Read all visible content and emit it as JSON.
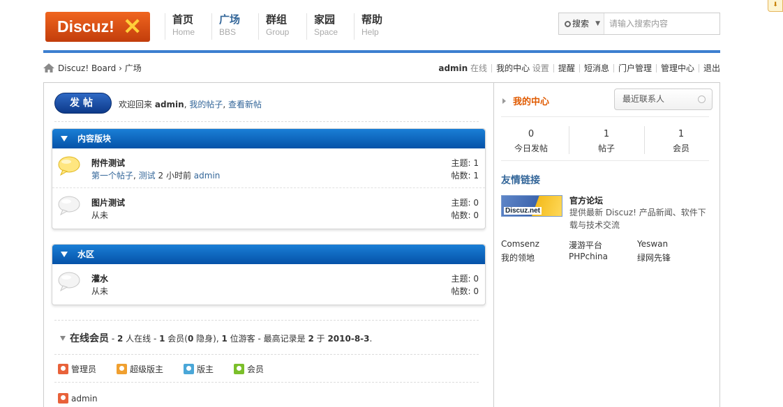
{
  "header": {
    "logo_text": "Discuz!",
    "nav": [
      {
        "cn": "首页",
        "en": "Home"
      },
      {
        "cn": "广场",
        "en": "BBS"
      },
      {
        "cn": "群组",
        "en": "Group"
      },
      {
        "cn": "家园",
        "en": "Space"
      },
      {
        "cn": "帮助",
        "en": "Help"
      }
    ],
    "active_nav": "BBS",
    "search": {
      "scope": "搜索",
      "placeholder": "请输入搜索内容"
    }
  },
  "breadcrumb": {
    "site": "Discuz! Board",
    "separator": "›",
    "current": "广场"
  },
  "userbar": {
    "username": "admin",
    "status": "在线",
    "my_center": "我的中心",
    "settings": "设置",
    "reminders": "提醒",
    "messages": "短消息",
    "portal_admin": "门户管理",
    "admin_center": "管理中心",
    "logout": "退出"
  },
  "main": {
    "post_button": "发帖",
    "welcome": {
      "prefix": "欢迎回来",
      "username": "admin",
      "my_posts": "我的帖子",
      "view_new": "查看新帖"
    },
    "sections": [
      {
        "title": "内容版块",
        "forums": [
          {
            "name": "附件测试",
            "last_post_title": "第一个帖子",
            "last_post_sep": ",",
            "last_post_forum": "测试",
            "last_post_time": "2 小时前",
            "last_post_user": "admin",
            "threads_label": "主题:",
            "threads": "1",
            "posts_label": "帖数:",
            "posts": "1",
            "has_new": true
          },
          {
            "name": "图片测试",
            "last_post_never": "从未",
            "threads_label": "主题:",
            "threads": "0",
            "posts_label": "帖数:",
            "posts": "0",
            "has_new": false
          }
        ]
      },
      {
        "title": "水区",
        "forums": [
          {
            "name": "灌水",
            "last_post_never": "从未",
            "threads_label": "主题:",
            "threads": "0",
            "posts_label": "帖数:",
            "posts": "0",
            "has_new": false
          }
        ]
      }
    ],
    "online": {
      "title": "在线会员",
      "t1": "- ",
      "count_online": "2",
      "t2": " 人在线 - ",
      "count_members": "1",
      "t3": " 会员(",
      "count_hidden": "0",
      "t4": " 隐身), ",
      "count_guests": "1",
      "t5": " 位游客 - 最高记录是 ",
      "max_record": "2",
      "t6": " 于 ",
      "record_date": "2010-8-3",
      "t7": "."
    },
    "legend": [
      {
        "label": "管理员",
        "color": "#e8623a"
      },
      {
        "label": "超级版主",
        "color": "#f0a030"
      },
      {
        "label": "版主",
        "color": "#4aa7d8"
      },
      {
        "label": "会员",
        "color": "#7bbf2a"
      }
    ],
    "online_users": [
      {
        "name": "admin",
        "color": "#e8623a"
      }
    ]
  },
  "sidebar": {
    "my_center": "我的中心",
    "recent_contacts": "最近联系人",
    "stats": [
      {
        "value": "0",
        "label": "今日发帖"
      },
      {
        "value": "1",
        "label": "帖子"
      },
      {
        "value": "1",
        "label": "会员"
      }
    ],
    "links_title": "友情链接",
    "official": {
      "banner": "Discuz.net",
      "name": "官方论坛",
      "desc": "提供最新 Discuz! 产品新闻、软件下载与技术交流"
    },
    "links": [
      "Comsenz",
      "漫游平台",
      "Yeswan",
      "我的领地",
      "PHPchina",
      "绿网先锋"
    ]
  }
}
